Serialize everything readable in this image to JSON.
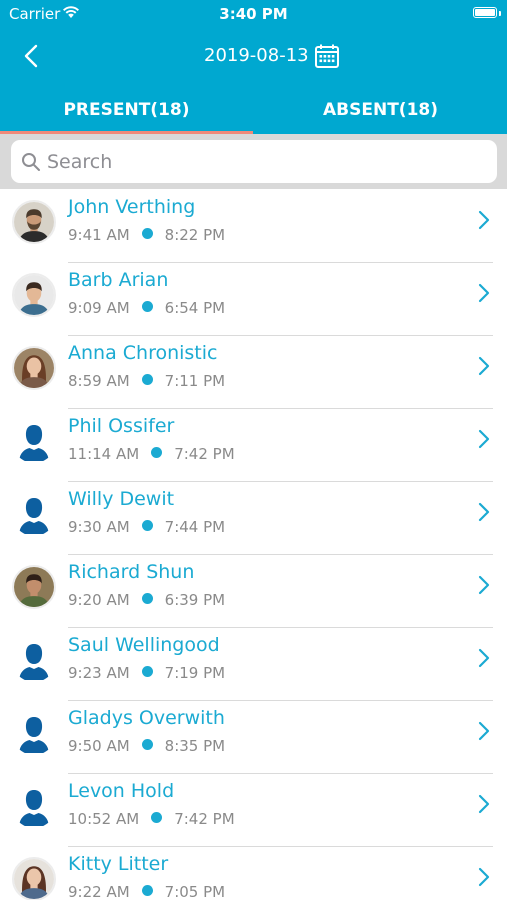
{
  "status_bar": {
    "carrier": "Carrier",
    "time": "3:40 PM"
  },
  "header": {
    "date": "2019-08-13"
  },
  "tabs": [
    {
      "label": "PRESENT(18)",
      "active": true
    },
    {
      "label": "ABSENT(18)",
      "active": false
    }
  ],
  "search": {
    "placeholder": "Search",
    "value": ""
  },
  "colors": {
    "accent": "#00A8D0",
    "name": "#1BAAD2",
    "indicator": "#F08A7A",
    "silhouette": "#0D5FA0"
  },
  "people": [
    {
      "name": "John Verthing",
      "in": "9:41 AM",
      "out": "8:22 PM",
      "avatar": "photo-bearded-man"
    },
    {
      "name": "Barb Arian",
      "in": "9:09 AM",
      "out": "6:54 PM",
      "avatar": "photo-man"
    },
    {
      "name": "Anna Chronistic",
      "in": "8:59 AM",
      "out": "7:11 PM",
      "avatar": "photo-woman"
    },
    {
      "name": "Phil Ossifer",
      "in": "11:14 AM",
      "out": "7:42 PM",
      "avatar": "silhouette"
    },
    {
      "name": "Willy Dewit",
      "in": "9:30 AM",
      "out": "7:44 PM",
      "avatar": "silhouette"
    },
    {
      "name": "Richard Shun",
      "in": "9:20 AM",
      "out": "6:39 PM",
      "avatar": "photo-man-smiling"
    },
    {
      "name": "Saul Wellingood",
      "in": "9:23 AM",
      "out": "7:19 PM",
      "avatar": "silhouette"
    },
    {
      "name": "Gladys Overwith",
      "in": "9:50 AM",
      "out": "8:35 PM",
      "avatar": "silhouette"
    },
    {
      "name": "Levon Hold",
      "in": "10:52 AM",
      "out": "7:42 PM",
      "avatar": "silhouette"
    },
    {
      "name": "Kitty Litter",
      "in": "9:22 AM",
      "out": "7:05 PM",
      "avatar": "photo-woman-2"
    }
  ]
}
